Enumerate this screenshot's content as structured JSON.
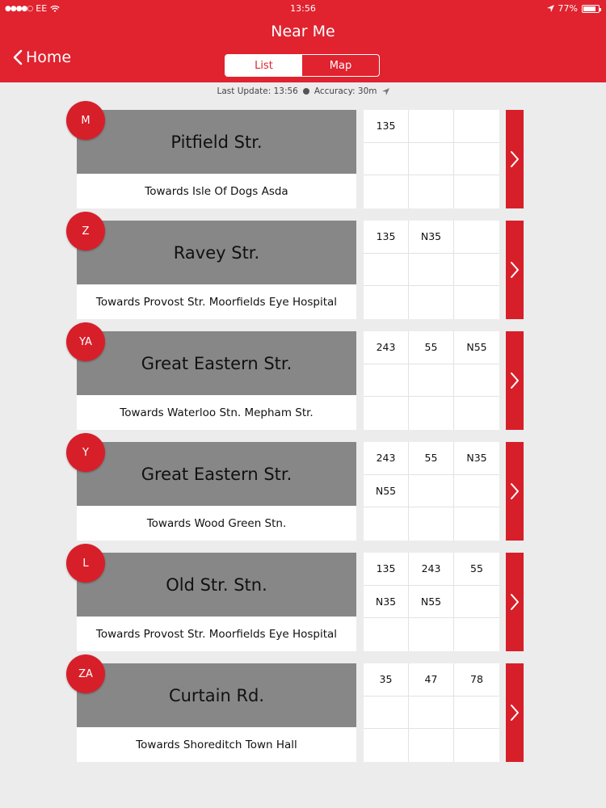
{
  "statusbar": {
    "carrier": "EE",
    "time": "13:56",
    "battery": "77%"
  },
  "nav": {
    "title": "Near Me",
    "back_label": "Home"
  },
  "segments": {
    "list_label": "List",
    "map_label": "Map",
    "selected": "List"
  },
  "status": {
    "last_update": "Last Update: 13:56",
    "accuracy": "Accuracy: 30m"
  },
  "colors": {
    "accent": "#e0232f",
    "name_band": "#878787"
  },
  "stops": [
    {
      "letter": "M",
      "name": "Pitfield Str.",
      "towards": "Towards Isle Of Dogs Asda",
      "routes": [
        "135",
        "",
        "",
        "",
        "",
        "",
        "",
        "",
        ""
      ]
    },
    {
      "letter": "Z",
      "name": "Ravey Str.",
      "towards": "Towards Provost Str.  Moorfields Eye Hospital",
      "routes": [
        "135",
        "N35",
        "",
        "",
        "",
        "",
        "",
        "",
        ""
      ]
    },
    {
      "letter": "YA",
      "name": "Great Eastern Str.",
      "towards": "Towards Waterloo Stn.  Mepham Str.",
      "routes": [
        "243",
        "55",
        "N55",
        "",
        "",
        "",
        "",
        "",
        ""
      ]
    },
    {
      "letter": "Y",
      "name": "Great Eastern Str.",
      "towards": "Towards Wood Green Stn.",
      "routes": [
        "243",
        "55",
        "N35",
        "N55",
        "",
        "",
        "",
        "",
        ""
      ]
    },
    {
      "letter": "L",
      "name": "Old Str. Stn.",
      "towards": "Towards Provost Str.  Moorfields Eye Hospital",
      "routes": [
        "135",
        "243",
        "55",
        "N35",
        "N55",
        "",
        "",
        "",
        ""
      ]
    },
    {
      "letter": "ZA",
      "name": "Curtain Rd.",
      "towards": "Towards Shoreditch Town Hall",
      "routes": [
        "35",
        "47",
        "78",
        "",
        "",
        "",
        "",
        "",
        ""
      ]
    }
  ]
}
